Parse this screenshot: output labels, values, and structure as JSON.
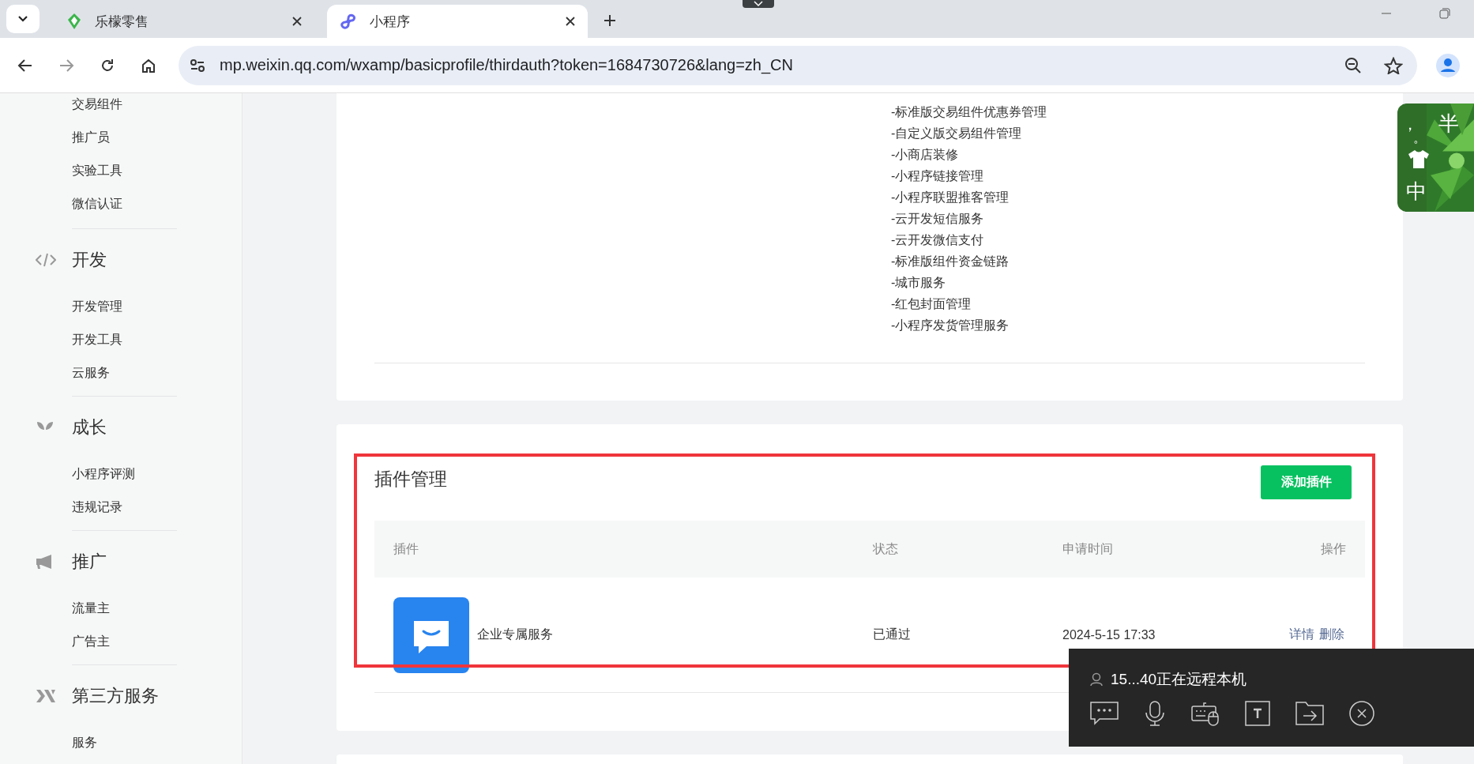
{
  "browser": {
    "tabs": [
      {
        "title": "乐檬零售",
        "kind": "leaf",
        "selected": false
      },
      {
        "title": "小程序",
        "kind": "link",
        "selected": true
      }
    ],
    "url": "mp.weixin.qq.com/wxamp/basicprofile/thirdauth?token=1684730726&lang=zh_CN"
  },
  "sidebar": {
    "top_items": [
      "交易组件",
      "推广员",
      "实验工具",
      "微信认证"
    ],
    "sections": [
      {
        "title": "开发",
        "kind": "code",
        "items": [
          "开发管理",
          "开发工具",
          "云服务"
        ]
      },
      {
        "title": "成长",
        "kind": "sprout",
        "items": [
          "小程序评测",
          "违规记录"
        ]
      },
      {
        "title": "推广",
        "kind": "megaphone",
        "items": [
          "流量主",
          "广告主"
        ]
      },
      {
        "title": "第三方服务",
        "kind": "third",
        "items": [
          "服务"
        ]
      }
    ]
  },
  "permissions": [
    "-标准版交易组件优惠券管理",
    "-自定义版交易组件管理",
    "-小商店装修",
    "-小程序链接管理",
    "-小程序联盟推客管理",
    "-云开发短信服务",
    "-云开发微信支付",
    "-标准版组件资金链路",
    "-城市服务",
    "-红包封面管理",
    "-小程序发货管理服务"
  ],
  "plugins": {
    "title": "插件管理",
    "add_button": "添加插件",
    "columns": [
      "插件",
      "状态",
      "申请时间",
      "操作"
    ],
    "rows": [
      {
        "name": "企业专属服务",
        "status": "已通过",
        "time": "2024-5-15 17:33",
        "actions": [
          "详情",
          "删除"
        ]
      }
    ]
  },
  "ime": {
    "mode": "半",
    "punct": [
      "，",
      "。"
    ],
    "lang": "中"
  },
  "remote_panel": {
    "message": "15...40正在远程本机"
  }
}
